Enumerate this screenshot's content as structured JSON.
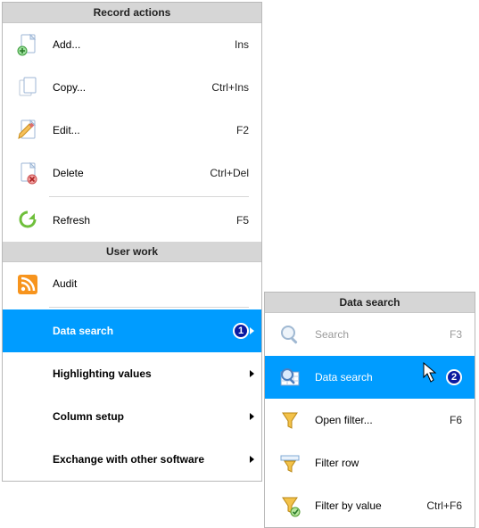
{
  "main": {
    "sections": {
      "record_actions": "Record actions",
      "user_work": "User work"
    },
    "items": {
      "add": {
        "label": "Add...",
        "shortcut": "Ins"
      },
      "copy": {
        "label": "Copy...",
        "shortcut": "Ctrl+Ins"
      },
      "edit": {
        "label": "Edit...",
        "shortcut": "F2"
      },
      "delete": {
        "label": "Delete",
        "shortcut": "Ctrl+Del"
      },
      "refresh": {
        "label": "Refresh",
        "shortcut": "F5"
      },
      "audit": {
        "label": "Audit"
      },
      "data_search": {
        "label": "Data search"
      },
      "highlight": {
        "label": "Highlighting values"
      },
      "col_setup": {
        "label": "Column setup"
      },
      "exchange": {
        "label": "Exchange with other software"
      }
    },
    "badges": {
      "data_search": "1"
    }
  },
  "sub": {
    "header": "Data search",
    "items": {
      "search": {
        "label": "Search",
        "shortcut": "F3"
      },
      "data_search": {
        "label": "Data search"
      },
      "open_filter": {
        "label": "Open filter...",
        "shortcut": "F6"
      },
      "filter_row": {
        "label": "Filter row"
      },
      "filter_value": {
        "label": "Filter by value",
        "shortcut": "Ctrl+F6"
      }
    },
    "badges": {
      "data_search": "2"
    }
  }
}
